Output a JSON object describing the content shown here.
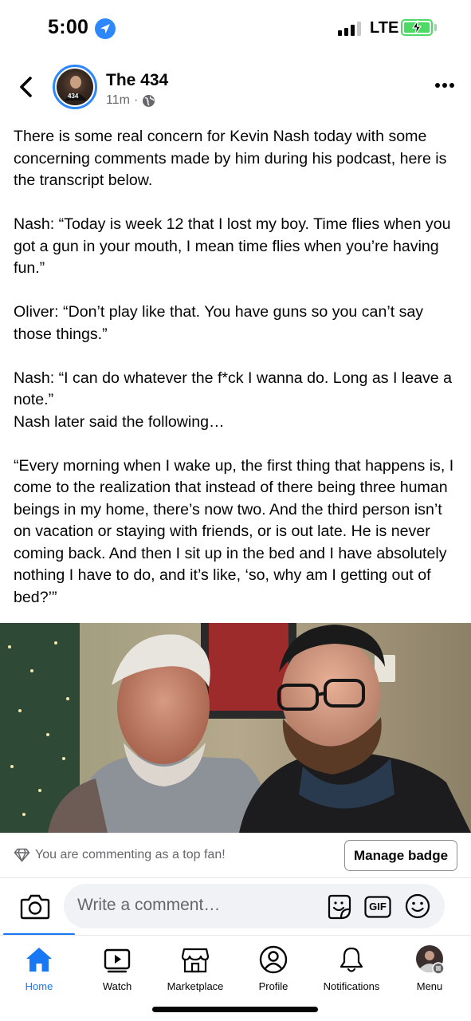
{
  "status_bar": {
    "time": "5:00",
    "network": "LTE",
    "signal_bars_active": 3,
    "signal_bars_total": 4,
    "battery_charging": true,
    "battery_color": "#4cd964"
  },
  "post": {
    "page_name": "The 434",
    "avatar_text": "434",
    "timestamp": "11m",
    "separator": "·",
    "privacy_icon": "globe-icon",
    "paragraphs": [
      "There is some real concern for Kevin Nash today with some concerning comments made by him during his podcast, here is the transcript below.",
      "Nash: “Today is week 12 that I lost my boy. Time flies when you got a gun in your mouth, I mean time flies when you’re having fun.”",
      "Oliver: “Don’t play like that. You have guns so you can’t say those things.”",
      "Nash: “I can do whatever the f*ck I wanna do. Long as I leave a note.”\nNash later said the following…",
      "“Every morning when I wake up, the first thing that happens is, I come to the realization that instead of there being three human beings in my home, there’s now two. And the third person isn’t on vacation or staying with friends, or is out late. He is never coming back. And then I sit up in the bed and I have absolutely nothing I have to do, and it’s like, ‘so, why am I getting out of bed?’”"
    ]
  },
  "comment_area": {
    "top_fan_text": "You are commenting as a top fan!",
    "manage_badge_label": "Manage badge",
    "comment_placeholder": "Write a comment…",
    "gif_label": "GIF"
  },
  "bottom_nav": {
    "items": [
      {
        "label": "Home",
        "icon": "home-icon",
        "active": true
      },
      {
        "label": "Watch",
        "icon": "watch-icon",
        "active": false
      },
      {
        "label": "Marketplace",
        "icon": "marketplace-icon",
        "active": false
      },
      {
        "label": "Profile",
        "icon": "profile-icon",
        "active": false
      },
      {
        "label": "Notifications",
        "icon": "notifications-icon",
        "active": false
      },
      {
        "label": "Menu",
        "icon": "menu-avatar-icon",
        "active": false
      }
    ]
  },
  "colors": {
    "accent": "#1877f2",
    "secondary_text": "#65676b",
    "composer_bg": "#f0f2f5"
  }
}
